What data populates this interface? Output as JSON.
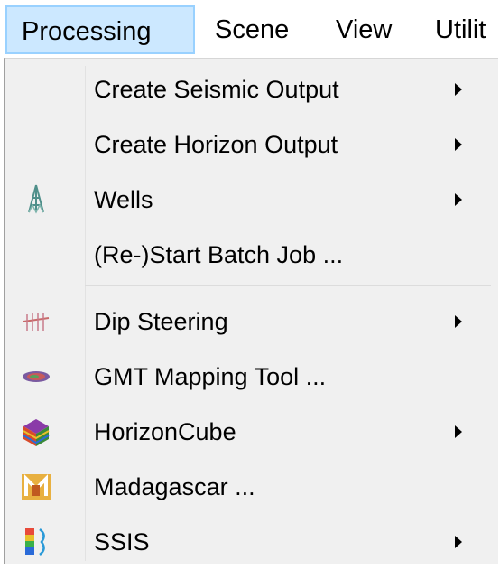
{
  "menubar": {
    "items": [
      "Processing",
      "Scene",
      "View",
      "Utilit"
    ]
  },
  "menu": {
    "items": [
      {
        "label": "Create Seismic Output",
        "icon": "",
        "submenu": true
      },
      {
        "label": "Create Horizon Output",
        "icon": "",
        "submenu": true
      },
      {
        "label": "Wells",
        "icon": "well-derrick-icon",
        "submenu": true
      },
      {
        "label": "(Re-)Start Batch Job ...",
        "icon": "",
        "submenu": false
      },
      {
        "label": "Dip Steering",
        "icon": "dip-steering-icon",
        "submenu": true
      },
      {
        "label": "GMT Mapping Tool ...",
        "icon": "gmt-mapping-icon",
        "submenu": false
      },
      {
        "label": "HorizonCube",
        "icon": "horizoncube-icon",
        "submenu": true
      },
      {
        "label": "Madagascar ...",
        "icon": "madagascar-icon",
        "submenu": false
      },
      {
        "label": "SSIS",
        "icon": "ssis-icon",
        "submenu": true
      }
    ]
  },
  "colors": {
    "menubar_active_bg": "#cce8ff",
    "menubar_active_border": "#99d1ff",
    "menu_bg": "#f0f0f0"
  }
}
